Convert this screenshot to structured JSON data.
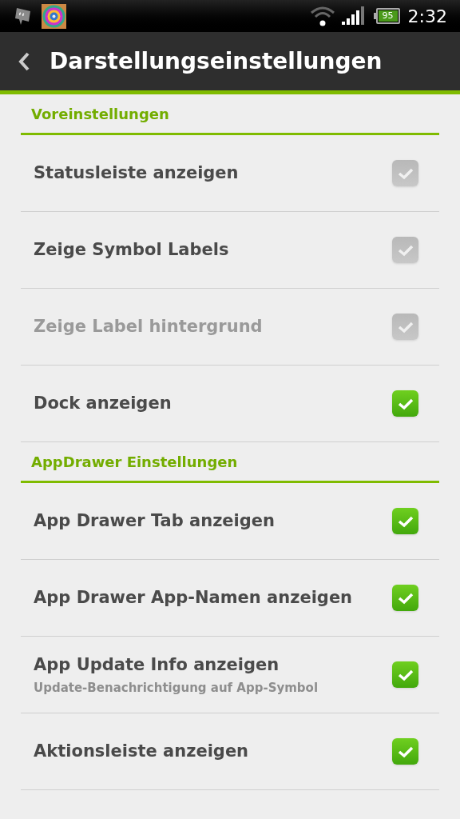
{
  "status_bar": {
    "battery": "95",
    "time": "2:32"
  },
  "action_bar": {
    "title": "Darstellungseinstellungen"
  },
  "sections": [
    {
      "title": "Voreinstellungen",
      "items": [
        {
          "label": "Statusleiste anzeigen",
          "checked": true,
          "checkbox_disabled": true,
          "disabled": false
        },
        {
          "label": "Zeige Symbol Labels",
          "checked": true,
          "checkbox_disabled": true,
          "disabled": false
        },
        {
          "label": "Zeige Label hintergrund",
          "checked": true,
          "checkbox_disabled": true,
          "disabled": true
        },
        {
          "label": "Dock anzeigen",
          "checked": true,
          "checkbox_disabled": false,
          "disabled": false
        }
      ]
    },
    {
      "title": "AppDrawer Einstellungen",
      "items": [
        {
          "label": "App Drawer Tab anzeigen",
          "checked": true,
          "checkbox_disabled": false,
          "disabled": false
        },
        {
          "label": "App Drawer App-Namen anzeigen",
          "checked": true,
          "checkbox_disabled": false,
          "disabled": false
        },
        {
          "label": "App Update Info anzeigen",
          "summary": "Update-Benachrichtigung auf App-Symbol",
          "checked": true,
          "checkbox_disabled": false,
          "disabled": false
        },
        {
          "label": "Aktionsleiste anzeigen",
          "checked": true,
          "checkbox_disabled": false,
          "disabled": false
        }
      ]
    }
  ]
}
